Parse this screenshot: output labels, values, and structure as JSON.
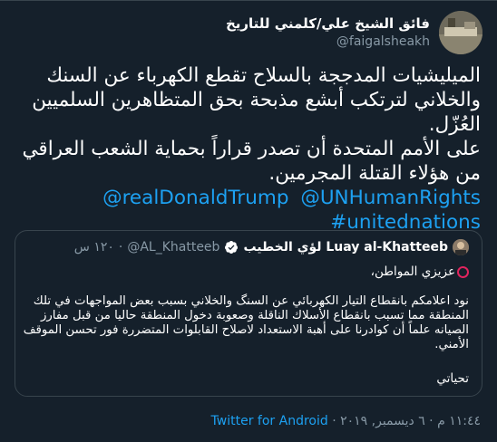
{
  "author": {
    "display_name": "فائق الشيخ علي/كلمني للتاريخ",
    "handle": "@faigalsheakh"
  },
  "tweet": {
    "paragraph_1": "الميليشيات المدججة بالسلاح تقطع الكهرباء عن السنك والخلاني لترتكب أبشع مذبحة بحق المتظاهرين السلميين العُزّل.",
    "paragraph_2": "على الأمم المتحدة أن تصدر قراراً بحماية الشعب العراقي من هؤلاء القتلة المجرمين.",
    "mentions": [
      "@realDonaldTrump",
      "@UNHumanRights",
      "#unitednations"
    ]
  },
  "quoted_tweet": {
    "display_name": "لؤي الخطيب Luay al-Khatteeb",
    "handle": "@AL_Khatteeb",
    "separator": "·",
    "time": "١٢٠ س",
    "greeting": "عزيزي المواطن،",
    "body": "نود اعلامكم بانقطاع التيار الكهربائي عن السنگ والخلاني بسبب بعض المواجهات في تلك المنطقة مما تسبب بانقطاع الأسلاك الناقلة وصعوبة دخول المنطقة حاليا من قبل مفارز الصيانه علماً أن كوادرنا على أهبة الاستعداد لاصلاح القابلوات المتضررة فور تحسن الموقف الأمني.",
    "signoff": "تحياتي"
  },
  "footer": {
    "time_date": "١١:٤٤ م · ٦ ديسمبر, ٢٠١٩",
    "separator": "·",
    "source": "Twitter for Android"
  },
  "colors": {
    "background": "#15202b",
    "link": "#1da1f2",
    "muted": "#8899a6",
    "border": "#38444d",
    "red_circle": "#e0245e"
  }
}
